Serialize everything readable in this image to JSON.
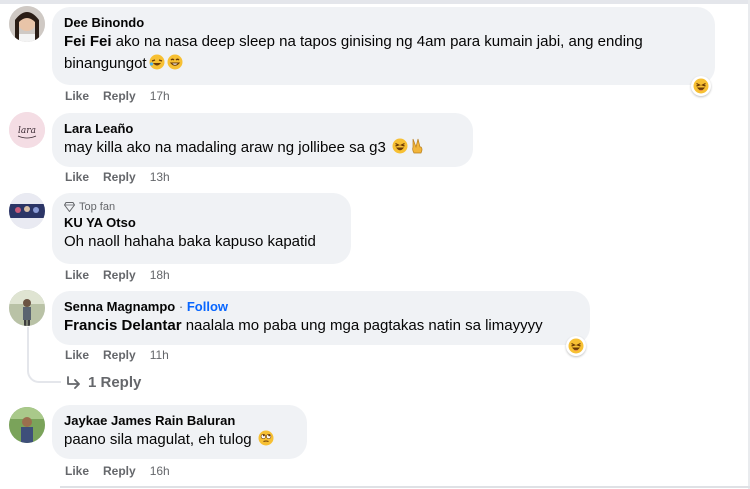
{
  "comments": [
    {
      "author": "Dee Binondo",
      "mention": "Fei Fei",
      "text_line1": " ako na nasa deep sleep na tapos ginising ng 4am para kumain jabi, ang ending",
      "text_line2": "binangungot",
      "emojis": [
        "rolling-laughing-emoji",
        "grinning-emoji"
      ],
      "reaction": "haha-reaction-icon",
      "like": "Like",
      "reply": "Reply",
      "time": "17h"
    },
    {
      "author": "Lara Leaño",
      "text": "may killa ako na madaling araw ng jollibee sa g3",
      "emojis": [
        "laughing-emoji",
        "victory-hand-emoji"
      ],
      "like": "Like",
      "reply": "Reply",
      "time": "13h"
    },
    {
      "badge": "Top fan",
      "author": "KU YA Otso",
      "text": "Oh naoll hahaha baka kapuso kapatid",
      "like": "Like",
      "reply": "Reply",
      "time": "18h"
    },
    {
      "author": "Senna Magnampo",
      "follow_sep": "·",
      "follow": "Follow",
      "mention": "Francis Delantar",
      "text": " naalala mo paba ung mga pagtakas natin sa limayyyy",
      "reaction": "haha-reaction-icon",
      "like": "Like",
      "reply": "Reply",
      "time": "11h",
      "replies": "1 Reply"
    },
    {
      "author": "Jaykae James Rain Baluran",
      "text": "paano sila magulat, eh tulog",
      "emojis": [
        "rolling-eyes-emoji"
      ],
      "like": "Like",
      "reply": "Reply",
      "time": "16h"
    }
  ],
  "colors": {
    "bubble": "#f0f2f5",
    "meta": "#65676b",
    "follow": "#0866ff",
    "emoji": "#f7c033"
  }
}
